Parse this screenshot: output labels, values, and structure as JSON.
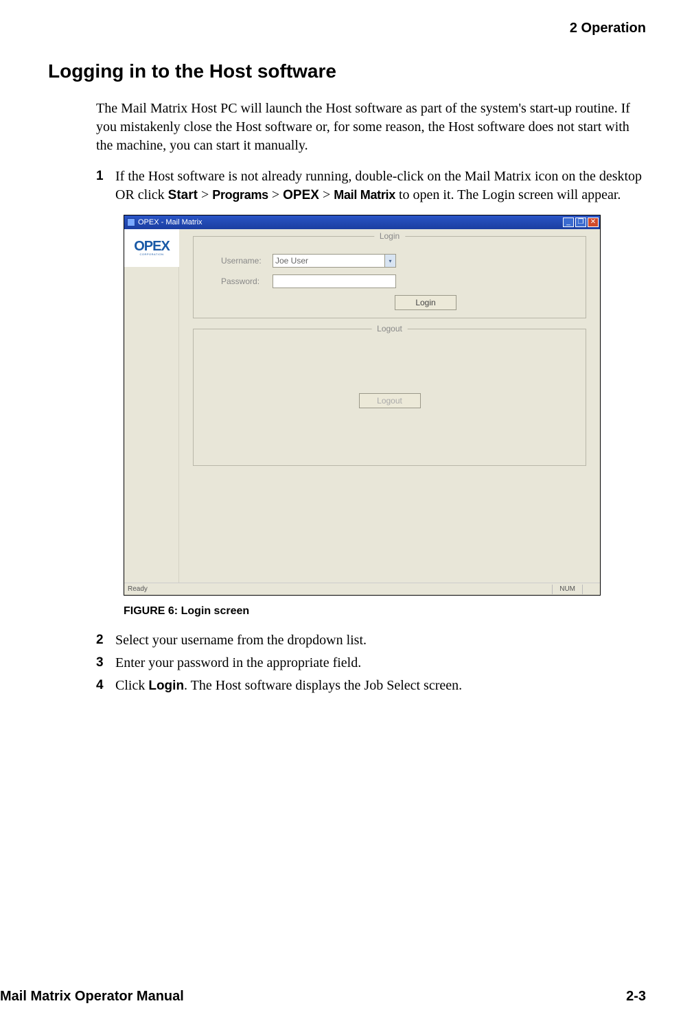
{
  "header": {
    "chapter": "2  Operation"
  },
  "section": {
    "title": "Logging in to the Host software"
  },
  "intro": "The Mail Matrix Host PC will launch the Host software as part of the system's start-up routine. If you mistakenly close the Host software or, for some reason, the Host software does not start with the machine, you can start it manually.",
  "steps": {
    "s1": {
      "num": "1",
      "pre": "If the Host software is not already running, double-click on the Mail Matrix icon on the desktop OR click ",
      "b1": "Start",
      "g1": " > ",
      "b2": "Programs",
      "g2": "  > ",
      "b3": "OPEX",
      "g3": " > ",
      "b4": "Mail Matrix",
      "post": " to open it. The Login screen will appear."
    },
    "s2": {
      "num": "2",
      "text": "Select your username from the dropdown list."
    },
    "s3": {
      "num": "3",
      "text": "Enter your password in the appropriate field."
    },
    "s4": {
      "num": "4",
      "pre": "Click ",
      "b1": "Login",
      "post": ". The Host software displays the Job Select screen."
    }
  },
  "figure": {
    "caption": "FIGURE 6: Login screen",
    "window": {
      "title": "OPEX - Mail Matrix",
      "logo": "OPEX",
      "logo_sub": "CORPORATION",
      "login_legend": "Login",
      "logout_legend": "Logout",
      "username_label": "Username:",
      "password_label": "Password:",
      "username_value": "Joe User",
      "login_btn": "Login",
      "logout_btn": "Logout",
      "status_ready": "Ready",
      "status_num": "NUM",
      "min": "_",
      "max": "❐",
      "close": "✕"
    }
  },
  "footer": {
    "left": "Mail Matrix Operator Manual",
    "right": "2-3"
  }
}
